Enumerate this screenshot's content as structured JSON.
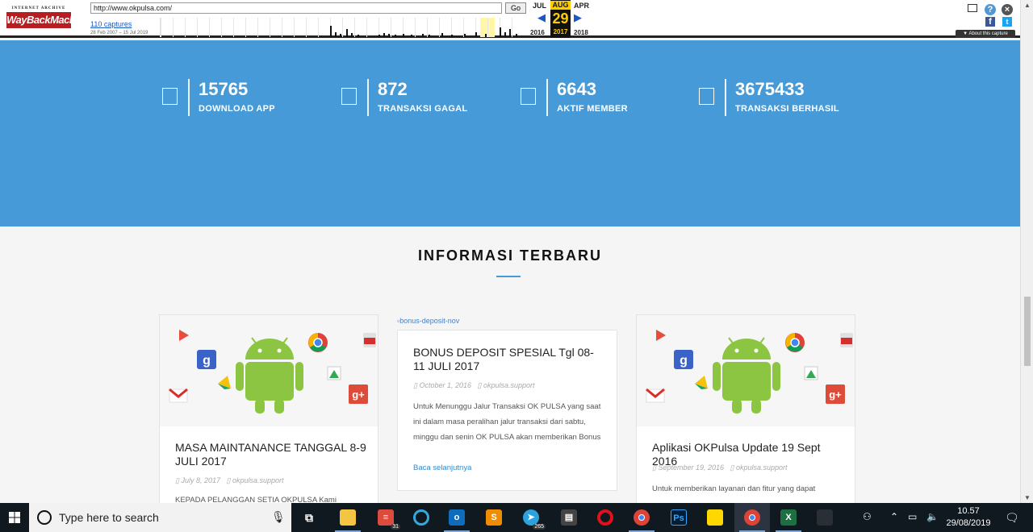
{
  "wayback": {
    "logo_top": "INTERNET ARCHIVE",
    "logo_main": "WayBackMachine",
    "url": "http://www.okpulsa.com/",
    "go": "Go",
    "captures": "110 captures",
    "range": "28 Feb 2007 – 15 Jul 2019",
    "prev_month": "JUL",
    "cur_month": "AUG",
    "next_month": "APR",
    "cur_day": "29",
    "prev_year": "2016",
    "cur_year": "2017",
    "next_year": "2018",
    "about": "▼ About this capture"
  },
  "stats": [
    {
      "value": "15765",
      "label": "DOWNLOAD APP"
    },
    {
      "value": "872",
      "label": "TRANSAKSI GAGAL"
    },
    {
      "value": "6643",
      "label": "AKTIF MEMBER"
    },
    {
      "value": "3675433",
      "label": "TRANSAKSI BERHASIL"
    }
  ],
  "section": {
    "title": "INFORMASI TERBARU"
  },
  "cards": [
    {
      "title": "MASA MAINTANANCE TANGGAL 8-9 JULI 2017",
      "date": "July 8, 2017",
      "author": "okpulsa.support",
      "excerpt": "KEPADA PELANGGAN SETIA OKPULSA Kami"
    },
    {
      "broken_img": "bonus-deposit-nov",
      "title": "BONUS DEPOSIT SPESIAL Tgl 08-11 JULI 2017",
      "date": "October 1, 2016",
      "author": "okpulsa.support",
      "excerpt": "Untuk Menunggu Jalur Transaksi OK PULSA yang saat ini dalam masa peralihan jalur transaksi dari sabtu, minggu dan senin OK PULSA akan memberikan Bonus",
      "more": "Baca selanjutnya"
    },
    {
      "title": "Aplikasi OKPulsa Update 19 Sept 2016",
      "date": "September 19, 2016",
      "author": "okpulsa.support",
      "excerpt": "Untuk memberikan layanan dan fitur yang dapat"
    }
  ],
  "taskbar": {
    "search_placeholder": "Type here to search",
    "calendar_badge": "31",
    "telegram_badge": "265",
    "time": "10.57",
    "date": "29/08/2019",
    "photoshop": "Ps",
    "excel": "X"
  },
  "icons": [
    "window-icon",
    "help-icon",
    "close-icon",
    "facebook-icon",
    "twitter-icon",
    "store-icon",
    "windows-start-icon",
    "cortana-icon",
    "microphone-icon",
    "task-view-icon",
    "file-explorer-icon",
    "todoist-icon",
    "chrome-icon",
    "outlook-icon",
    "sublime-icon",
    "telegram-icon",
    "opera-icon",
    "photoshop-icon",
    "sticky-notes-icon",
    "excel-icon",
    "notification-icon"
  ],
  "colors": {
    "accent": "#469ad8",
    "wayback_red": "#b81d22",
    "wayback_gold": "#ffcc00",
    "android_green": "#8bc541"
  }
}
